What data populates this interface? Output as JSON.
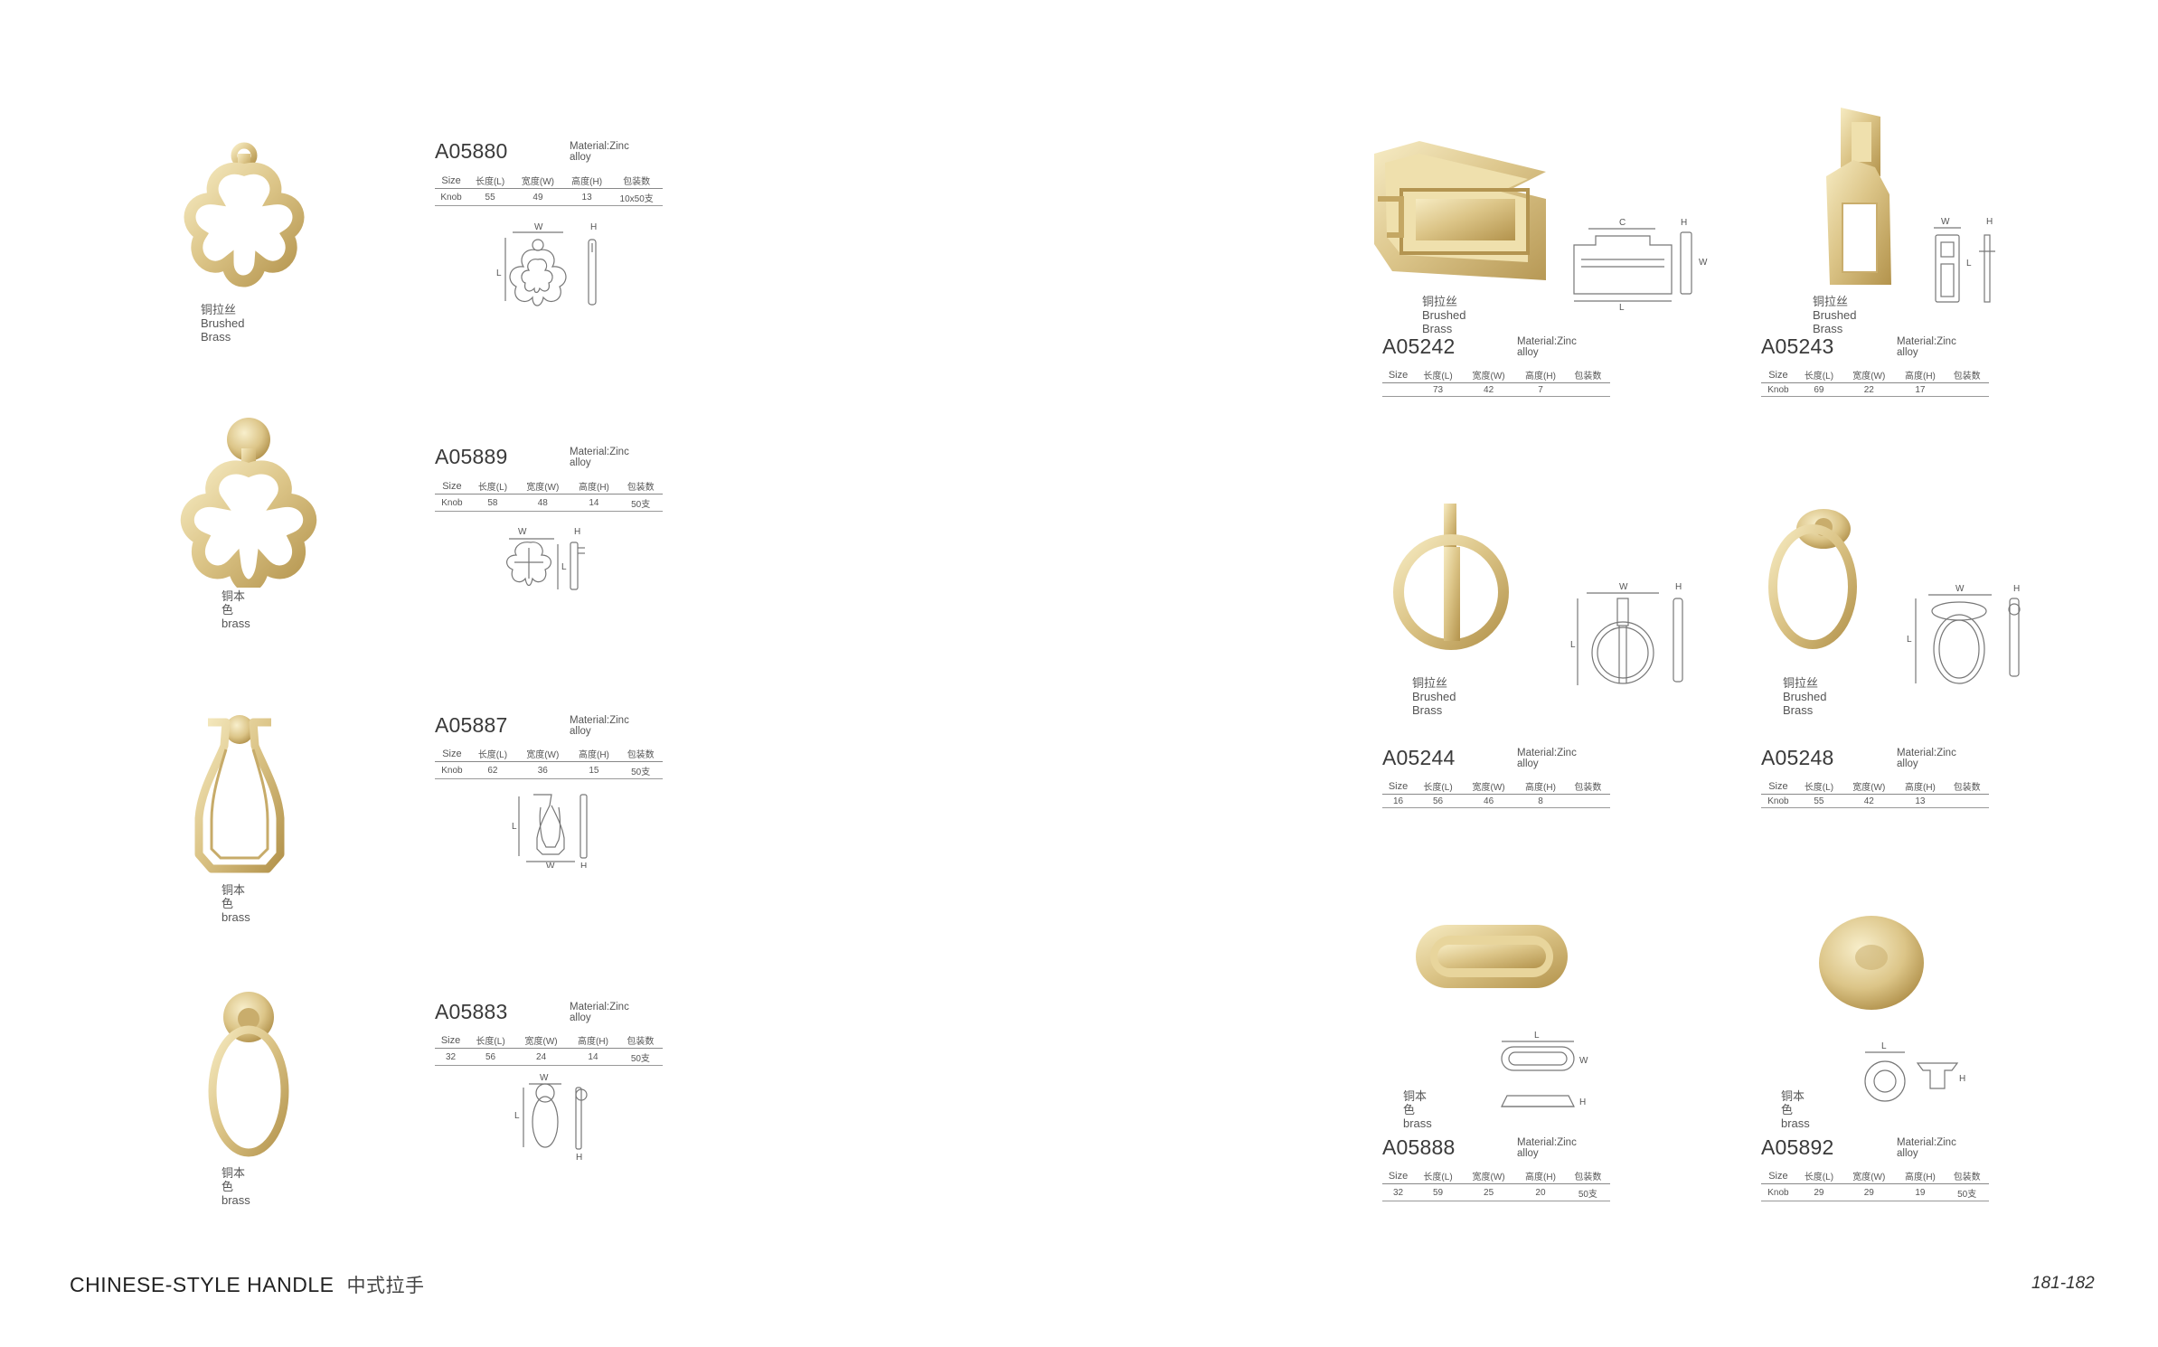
{
  "footer": {
    "title_en": "CHINESE-STYLE HANDLE",
    "title_cn": "中式拉手",
    "page_numbers": "181-182"
  },
  "spec_headers": [
    "Size",
    "长度(L)",
    "宽度(W)",
    "高度(H)",
    "包装数"
  ],
  "material_label": "Material:Zinc alloy",
  "colors": {
    "brass": "#dcc588",
    "brass_dark": "#b99a52",
    "brass_light": "#f3e6b8",
    "line": "#777777"
  },
  "products": [
    {
      "code": "A05880",
      "finish_cn": "铜拉丝",
      "finish_en": "Brushed Brass",
      "specs": [
        "Knob",
        "55",
        "49",
        "13",
        "10x50支"
      ],
      "icon": "quatrefoil-ring-pull-icon"
    },
    {
      "code": "A05889",
      "finish_cn": "铜本色",
      "finish_en": "brass",
      "specs": [
        "Knob",
        "58",
        "48",
        "14",
        "50支"
      ],
      "icon": "quatrefoil-ring-pull-icon"
    },
    {
      "code": "A05887",
      "finish_cn": "铜本色",
      "finish_en": "brass",
      "specs": [
        "Knob",
        "62",
        "36",
        "15",
        "50支"
      ],
      "icon": "pendant-drop-pull-icon"
    },
    {
      "code": "A05883",
      "finish_cn": "铜本色",
      "finish_en": "brass",
      "specs": [
        "32",
        "56",
        "24",
        "14",
        "50支"
      ],
      "icon": "oval-ring-pull-icon"
    },
    {
      "code": "A05242",
      "finish_cn": "铜拉丝",
      "finish_en": "Brushed Brass",
      "specs": [
        "",
        "73",
        "42",
        "7",
        ""
      ],
      "icon": "rectangular-bail-pull-icon"
    },
    {
      "code": "A05243",
      "finish_cn": "铜拉丝",
      "finish_en": "Brushed Brass",
      "specs": [
        "Knob",
        "69",
        "22",
        "17",
        ""
      ],
      "icon": "rectangular-drop-pull-icon"
    },
    {
      "code": "A05244",
      "finish_cn": "铜拉丝",
      "finish_en": "Brushed Brass",
      "specs": [
        "16",
        "56",
        "46",
        "8",
        ""
      ],
      "icon": "round-ring-pull-icon"
    },
    {
      "code": "A05248",
      "finish_cn": "铜拉丝",
      "finish_en": "Brushed Brass",
      "specs": [
        "Knob",
        "55",
        "42",
        "13",
        ""
      ],
      "icon": "oval-ring-pull-icon"
    },
    {
      "code": "A05888",
      "finish_cn": "铜本色",
      "finish_en": "brass",
      "specs": [
        "32",
        "59",
        "25",
        "20",
        "50支"
      ],
      "icon": "bar-pull-icon"
    },
    {
      "code": "A05892",
      "finish_cn": "铜本色",
      "finish_en": "brass",
      "specs": [
        "Knob",
        "29",
        "29",
        "19",
        "50支"
      ],
      "icon": "mushroom-knob-icon"
    }
  ]
}
